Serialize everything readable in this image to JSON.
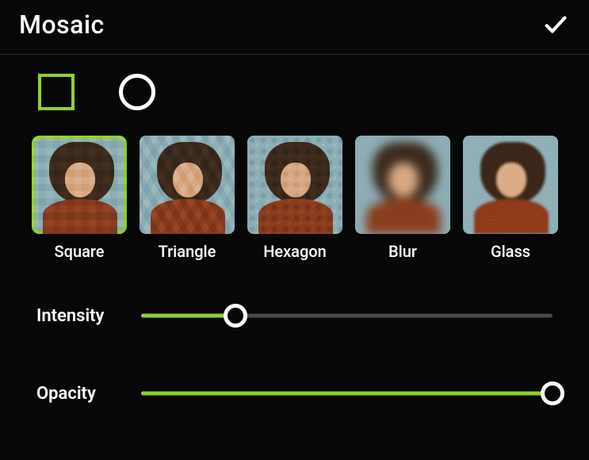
{
  "header": {
    "title": "Mosaic"
  },
  "shapes": {
    "selected": "square"
  },
  "effects": [
    {
      "id": "square",
      "label": "Square",
      "selected": true
    },
    {
      "id": "triangle",
      "label": "Triangle",
      "selected": false
    },
    {
      "id": "hexagon",
      "label": "Hexagon",
      "selected": false
    },
    {
      "id": "blur",
      "label": "Blur",
      "selected": false
    },
    {
      "id": "glass",
      "label": "Glass",
      "selected": false
    }
  ],
  "sliders": {
    "intensity": {
      "label": "Intensity",
      "value": 23
    },
    "opacity": {
      "label": "Opacity",
      "value": 100
    }
  },
  "colors": {
    "accent": "#8FD12E",
    "bg": "#070707"
  }
}
